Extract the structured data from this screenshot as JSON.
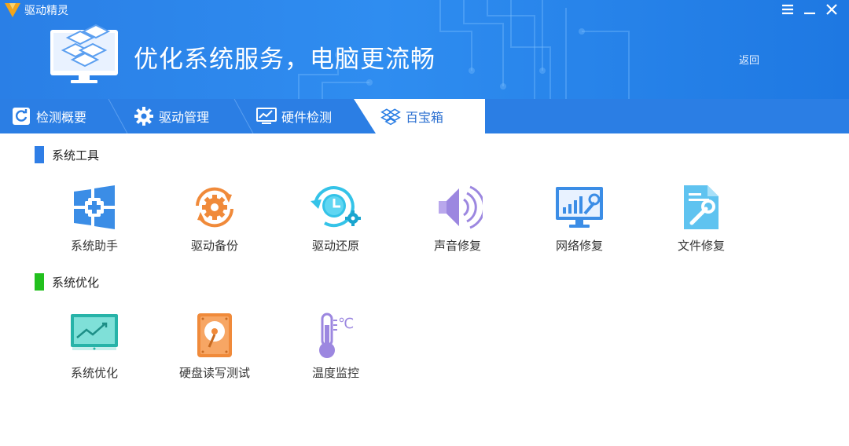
{
  "app": {
    "name": "驱动精灵"
  },
  "window_controls": {
    "menu": "☰",
    "minimize": "—",
    "close": "✕"
  },
  "header": {
    "slogan": "优化系统服务，电脑更流畅",
    "back_label": "返回"
  },
  "tabs": [
    {
      "label": "检测概要",
      "icon": "refresh-icon"
    },
    {
      "label": "驱动管理",
      "icon": "gear-icon"
    },
    {
      "label": "硬件检测",
      "icon": "monitor-chart-icon"
    },
    {
      "label": "百宝箱",
      "icon": "toolbox-icon",
      "active": true
    }
  ],
  "sections": [
    {
      "title": "系统工具",
      "accent": "#2f7ee6",
      "items": [
        {
          "label": "系统助手",
          "icon": "windows-plus-icon"
        },
        {
          "label": "驱动备份",
          "icon": "gear-backup-icon"
        },
        {
          "label": "驱动还原",
          "icon": "clock-restore-icon"
        },
        {
          "label": "声音修复",
          "icon": "speaker-icon"
        },
        {
          "label": "网络修复",
          "icon": "network-wrench-icon"
        },
        {
          "label": "文件修复",
          "icon": "file-wrench-icon"
        }
      ]
    },
    {
      "title": "系统优化",
      "accent": "#22c01e",
      "items": [
        {
          "label": "系统优化",
          "icon": "monitor-trend-icon"
        },
        {
          "label": "硬盘读写测试",
          "icon": "hard-disk-icon"
        },
        {
          "label": "温度监控",
          "icon": "thermometer-icon",
          "unit_text": "℃"
        }
      ]
    }
  ],
  "colors": {
    "header_blue": "#2f8df0",
    "tab_blue": "#2b7ee4",
    "active_tab_bg": "#ffffff"
  }
}
